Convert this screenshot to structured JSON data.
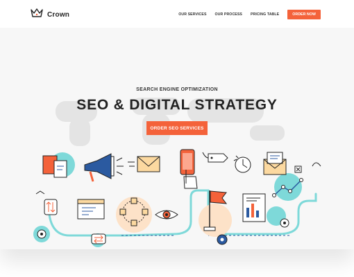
{
  "brand": {
    "name": "Crown",
    "accent": "#f4623a",
    "teal": "#7ed9d9"
  },
  "nav": {
    "items": [
      "OUR SERVICES",
      "OUR PROCESS",
      "PRICING TABLE"
    ],
    "cta_label": "ORDER NOW"
  },
  "hero": {
    "kicker": "SEARCH ENGINE OPTIMIZATION",
    "headline": "SEO & DIGITAL STRATEGY",
    "cta_label": "ORDER SEO SERVICES"
  },
  "icons": [
    "crown-icon",
    "document-icon",
    "megaphone-icon",
    "envelope-icon",
    "smartphone-touch-icon",
    "price-tag-icon",
    "stopwatch-icon",
    "open-mail-icon",
    "close-box-icon",
    "sort-arrows-icon",
    "browser-window-icon",
    "network-nodes-icon",
    "eye-icon",
    "flag-icon",
    "report-document-icon",
    "line-chart-icon",
    "gear-icon",
    "transfer-arrows-icon"
  ]
}
